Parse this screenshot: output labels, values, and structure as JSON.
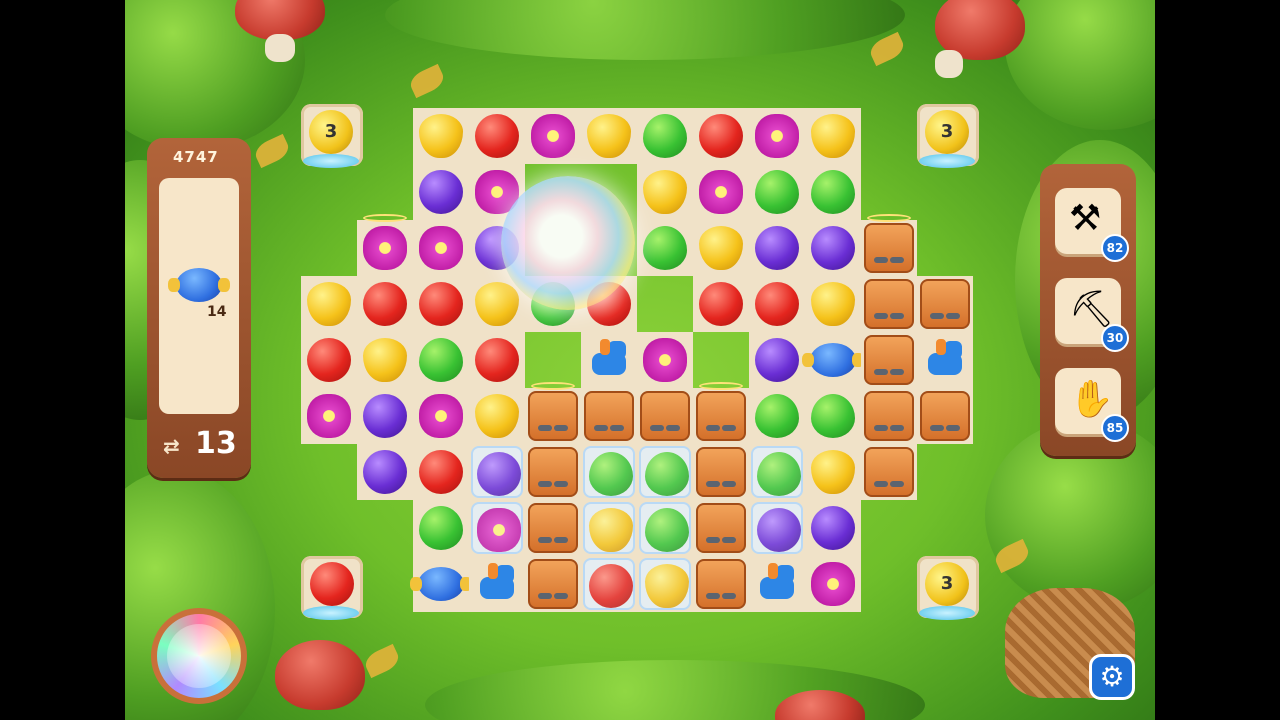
{
  "game": {
    "score": "4747",
    "moves_left": "13",
    "goal": {
      "item": "blue-egg-icon",
      "count": "14"
    }
  },
  "cannons": [
    {
      "label": "3"
    },
    {
      "label": "3"
    },
    {
      "label": "3"
    }
  ],
  "tools": [
    {
      "icon": "shovel-icon",
      "count": "82"
    },
    {
      "icon": "rake-icon",
      "count": "30"
    },
    {
      "icon": "glove-icon",
      "count": "85"
    }
  ],
  "colors": {
    "panel": "#9a5430",
    "grass": "#6fbf2a",
    "tile": "#f0e2c8",
    "badge": "#1e6fd6"
  }
}
